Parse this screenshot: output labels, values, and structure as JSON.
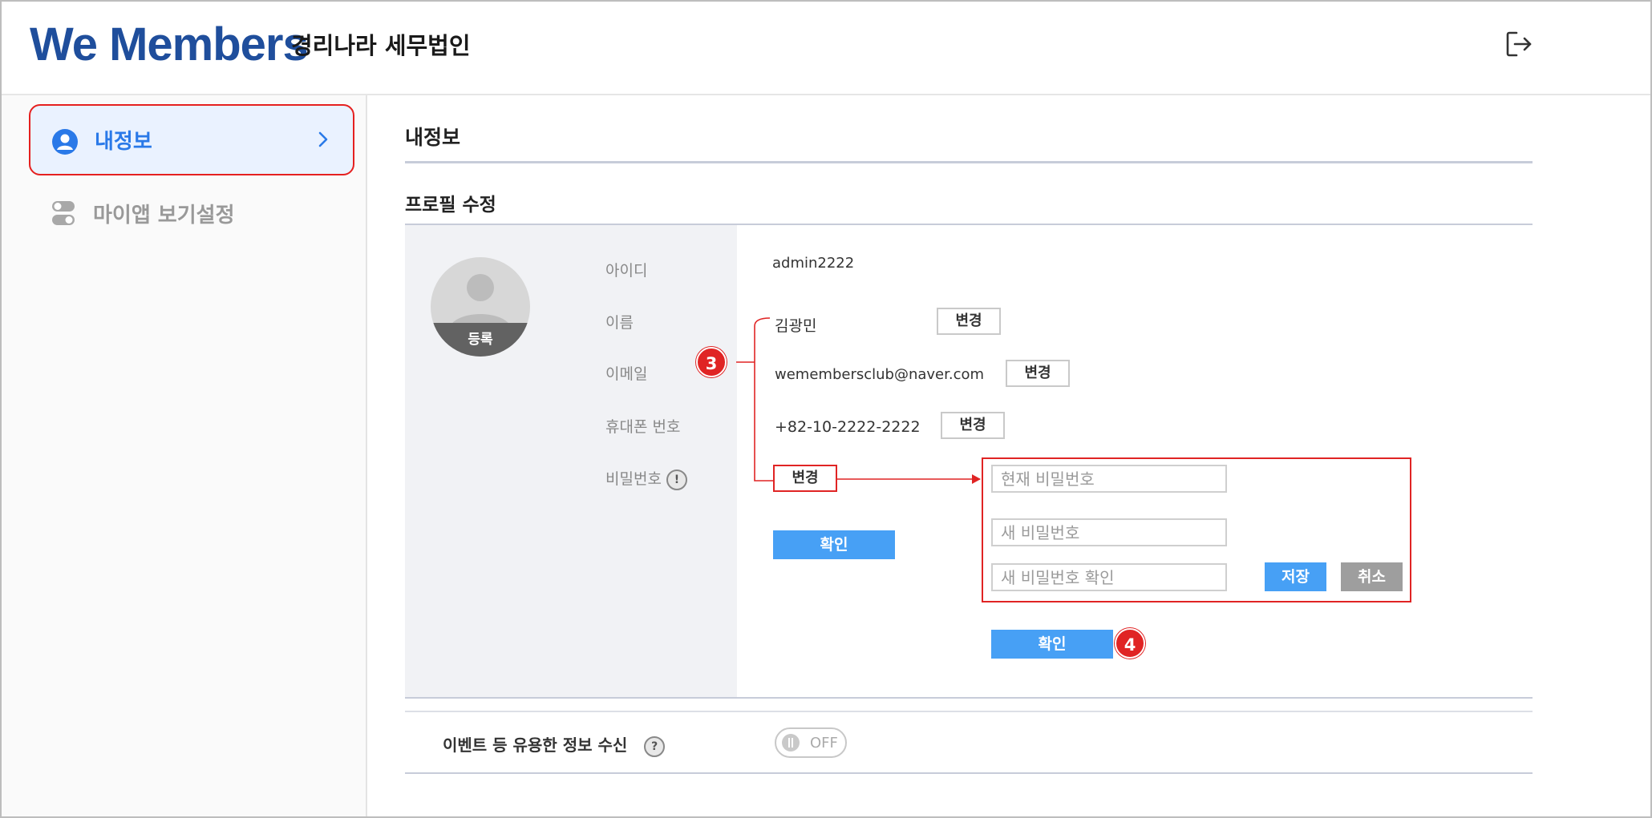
{
  "header": {
    "brand": "We Members",
    "company": "경리나라 세무법인",
    "logout_icon": "logout-icon"
  },
  "sidebar": {
    "items": [
      {
        "label": "내정보",
        "icon": "user-circle-icon",
        "active": true
      },
      {
        "label": "마이앱 보기설정",
        "icon": "toggle-settings-icon",
        "active": false
      }
    ]
  },
  "main": {
    "page_title": "내정보",
    "section_title": "프로필 수정",
    "avatar_label": "등록",
    "fields": {
      "id": {
        "label": "아이디",
        "value": "admin2222"
      },
      "name": {
        "label": "이름",
        "value": "김광민",
        "button": "변경"
      },
      "email": {
        "label": "이메일",
        "value": "wemembersclub@naver.com",
        "button": "변경"
      },
      "phone": {
        "label": "휴대폰 번호",
        "value": "+82-10-2222-2222",
        "button": "변경"
      },
      "password": {
        "label": "비밀번호",
        "info": "!",
        "button": "변경"
      }
    },
    "confirm_label": "확인",
    "password_panel": {
      "current_placeholder": "현재 비밀번호",
      "new_placeholder": "새 비밀번호",
      "confirm_placeholder": "새 비밀번호 확인",
      "save_label": "저장",
      "cancel_label": "취소"
    },
    "confirm2_label": "확인",
    "marketing": {
      "label": "이벤트 등 유용한 정보 수신",
      "help": "?",
      "toggle_state": "OFF"
    }
  },
  "annotations": {
    "step3": "3",
    "step4": "4"
  },
  "colors": {
    "brand": "#1f4e9c",
    "accent": "#2a79e8",
    "button_blue": "#47a0f5",
    "annotation_red": "#e02424"
  }
}
